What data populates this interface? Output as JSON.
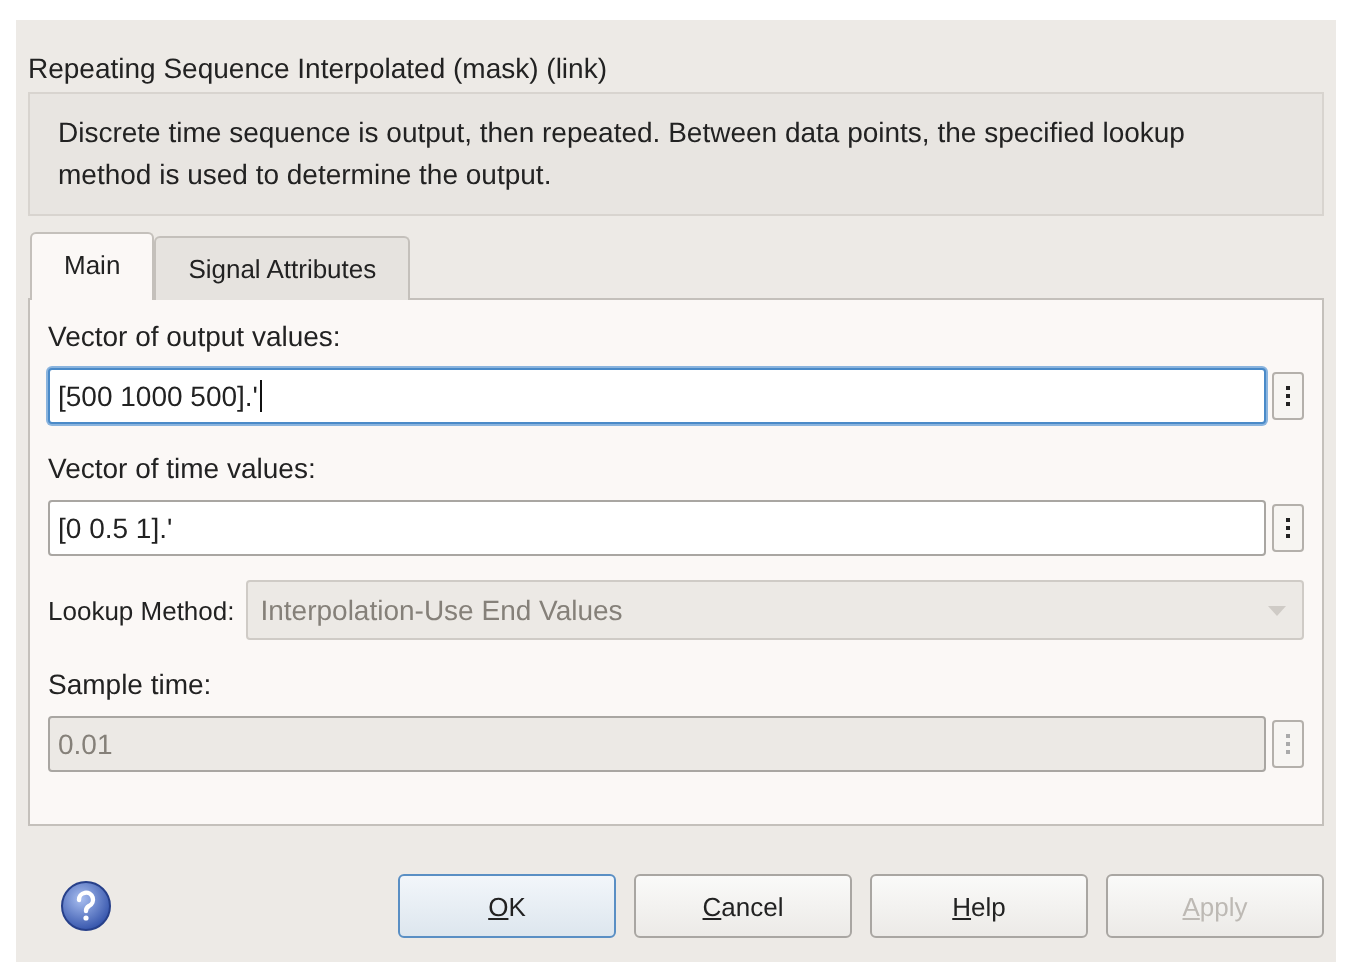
{
  "window": {
    "title": "Repeating Sequence Interpolated (mask) (link)"
  },
  "description": "Discrete time sequence is output, then repeated. Between data points, the specified lookup method is used to determine the output.",
  "tabs": [
    {
      "label": "Main",
      "selected": true
    },
    {
      "label": "Signal Attributes",
      "selected": false
    }
  ],
  "parameters": [
    {
      "kind": "text",
      "label": "Vector of output values:",
      "value": "[500 1000 500].'",
      "focused": true,
      "disabled": false
    },
    {
      "kind": "text",
      "label": "Vector of time values:",
      "value": "[0 0.5 1].'",
      "focused": false,
      "disabled": false
    },
    {
      "kind": "select",
      "label": "Lookup Method:",
      "value": "Interpolation-Use End Values",
      "disabled": true
    },
    {
      "kind": "text",
      "label": "Sample time:",
      "value": "0.01",
      "focused": false,
      "disabled": true
    }
  ],
  "buttons": [
    {
      "label": "OK",
      "default": true,
      "disabled": false
    },
    {
      "label": "Cancel",
      "default": false,
      "disabled": false
    },
    {
      "label": "Help",
      "default": false,
      "disabled": false
    },
    {
      "label": "Apply",
      "default": false,
      "disabled": true
    }
  ]
}
